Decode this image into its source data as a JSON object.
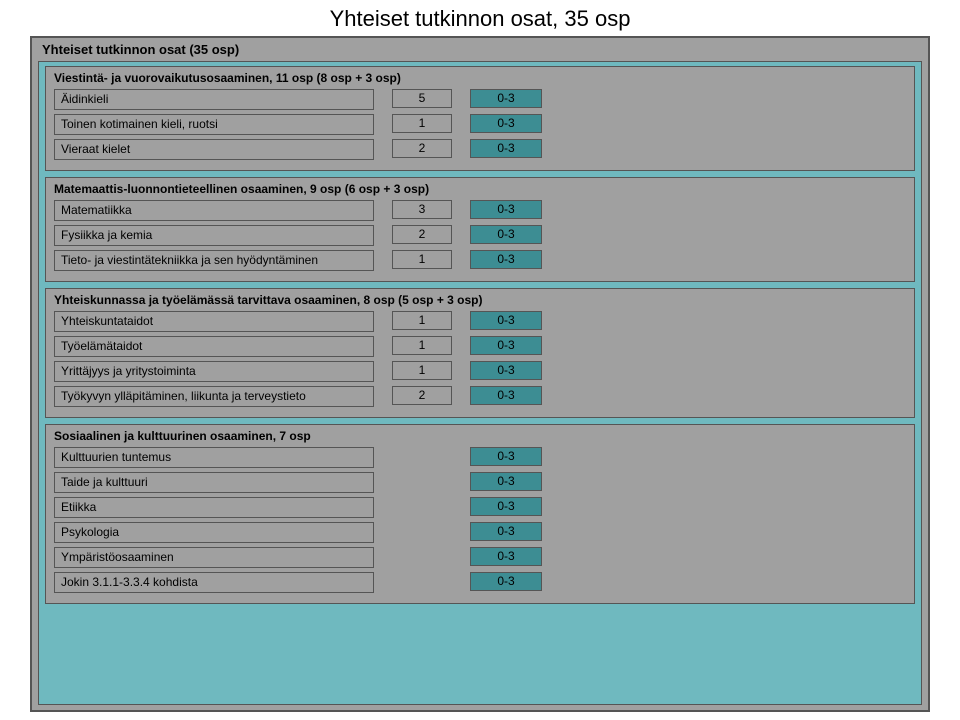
{
  "title": "Yhteiset tutkinnon osat, 35 osp",
  "outerHeader": "Yhteiset tutkinnon osat (35 osp)",
  "sections": [
    {
      "title": "Viestintä- ja vuorovaikutusosaaminen, 11 osp (8 osp + 3 osp)",
      "rows": [
        {
          "name": "Äidinkieli",
          "num": "5",
          "range": "0-3"
        },
        {
          "name": "Toinen kotimainen kieli, ruotsi",
          "num": "1",
          "range": "0-3"
        },
        {
          "name": "Vieraat kielet",
          "num": "2",
          "range": "0-3"
        }
      ]
    },
    {
      "title": "Matemaattis-luonnontieteellinen osaaminen, 9 osp (6 osp + 3 osp)",
      "rows": [
        {
          "name": "Matematiikka",
          "num": "3",
          "range": "0-3"
        },
        {
          "name": "Fysiikka ja  kemia",
          "num": "2",
          "range": "0-3"
        },
        {
          "name": "Tieto- ja viestintätekniikka ja sen hyödyntäminen",
          "num": "1",
          "range": "0-3"
        }
      ]
    },
    {
      "title": "Yhteiskunnassa  ja työelämässä tarvittava osaaminen, 8 osp (5 osp + 3 osp)",
      "rows": [
        {
          "name": "Yhteiskuntataidot",
          "num": "1",
          "range": "0-3"
        },
        {
          "name": "Työelämätaidot",
          "num": "1",
          "range": "0-3"
        },
        {
          "name": "Yrittäjyys ja yritystoiminta",
          "num": "1",
          "range": "0-3"
        },
        {
          "name": "Työkyvyn ylläpitäminen, liikunta ja terveystieto",
          "num": "2",
          "range": "0-3"
        }
      ]
    },
    {
      "title": "Sosiaalinen ja kulttuurinen osaaminen, 7 osp",
      "rows": [
        {
          "name": "Kulttuurien tuntemus",
          "num": "",
          "range": "0-3"
        },
        {
          "name": "Taide ja kulttuuri",
          "num": "",
          "range": "0-3"
        },
        {
          "name": "Etiikka",
          "num": "",
          "range": "0-3"
        },
        {
          "name": "Psykologia",
          "num": "",
          "range": "0-3"
        },
        {
          "name": "Ympäristöosaaminen",
          "num": "",
          "range": "0-3"
        },
        {
          "name": "Jokin 3.1.1-3.3.4 kohdista",
          "num": "",
          "range": "0-3"
        }
      ]
    }
  ]
}
